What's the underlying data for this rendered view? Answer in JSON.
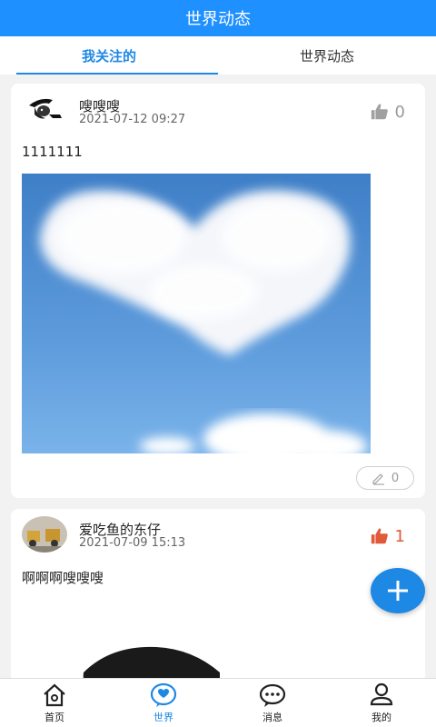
{
  "header": {
    "title": "世界动态"
  },
  "tabs": [
    {
      "label": "我关注的"
    },
    {
      "label": "世界动态"
    }
  ],
  "posts": [
    {
      "username": "嗖嗖嗖",
      "time": "2021-07-12 09:27",
      "likes": "0",
      "text": "1111111",
      "comments": "0",
      "image": "sky-with-heart-shaped-cloud"
    },
    {
      "username": "爱吃鱼的东仔",
      "time": "2021-07-09 15:13",
      "likes": "1",
      "text": "啊啊啊嗖嗖嗖",
      "image": "dark-silhouette"
    }
  ],
  "nav": [
    {
      "label": "首页",
      "icon": "home-icon"
    },
    {
      "label": "世界",
      "icon": "heart-chat-icon"
    },
    {
      "label": "消息",
      "icon": "message-icon"
    },
    {
      "label": "我的",
      "icon": "user-icon"
    }
  ],
  "colors": {
    "primary": "#1e90ff",
    "like_active": "#e05a3a",
    "like_inactive": "#9a9a9a"
  }
}
